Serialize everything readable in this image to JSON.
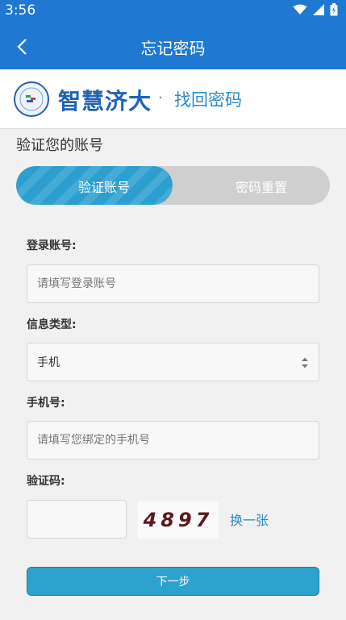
{
  "status": {
    "time": "3:56"
  },
  "nav": {
    "title": "忘记密码"
  },
  "brand": {
    "name": "智慧济大",
    "dot": "·",
    "subtitle": "找回密码"
  },
  "section": {
    "title": "验证您的账号"
  },
  "steps": [
    {
      "label": "验证账号",
      "active": true
    },
    {
      "label": "密码重置",
      "active": false
    }
  ],
  "form": {
    "account": {
      "label": "登录账号:",
      "placeholder": "请填写登录账号"
    },
    "info_type": {
      "label": "信息类型:",
      "value": "手机"
    },
    "phone": {
      "label": "手机号:",
      "placeholder": "请填写您绑定的手机号"
    },
    "captcha": {
      "label": "验证码:",
      "image_text": "4897",
      "refresh": "换一张"
    },
    "submit": "下一步"
  },
  "colors": {
    "primary": "#1f78d1",
    "accent": "#2ea2cf",
    "link": "#2a88c6"
  },
  "icons": [
    "wifi-icon",
    "signal-icon",
    "battery-icon",
    "back-arrow-icon",
    "select-arrows-icon",
    "logo-icon"
  ]
}
